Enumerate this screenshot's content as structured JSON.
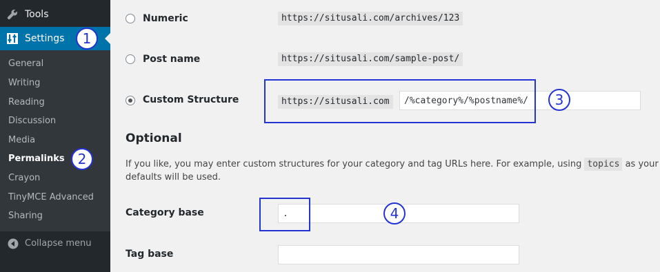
{
  "sidebar": {
    "tools_label": "Tools",
    "tools_icon": "wrench-icon",
    "settings_label": "Settings",
    "settings_icon": "sliders-icon",
    "submenu": [
      "General",
      "Writing",
      "Reading",
      "Discussion",
      "Media",
      "Permalinks",
      "Crayon",
      "TinyMCE Advanced",
      "Sharing"
    ],
    "current": "Permalinks",
    "collapse_label": "Collapse menu",
    "collapse_icon": "collapse-arrow-icon"
  },
  "permalinks": {
    "numeric_label": "Numeric",
    "numeric_example": "https://situsali.com/archives/123",
    "postname_label": "Post name",
    "postname_example": "https://situsali.com/sample-post/",
    "custom_label": "Custom Structure",
    "custom_prefix": "https://situsali.com",
    "custom_value": "/%category%/%postname%/",
    "selected": "Custom Structure"
  },
  "optional": {
    "heading": "Optional",
    "desc_part1": "If you like, you may enter custom structures for your category and tag URLs here. For example, using",
    "desc_code": "topics",
    "desc_part2": "as your",
    "desc_line2": "defaults will be used.",
    "category_base_label": "Category base",
    "category_base_value": ".",
    "tag_base_label": "Tag base",
    "tag_base_value": ""
  },
  "annotations": [
    "1",
    "2",
    "3",
    "4"
  ],
  "colors": {
    "sidebar_bg": "#23282d",
    "submenu_bg": "#32373c",
    "active_bg": "#0073aa",
    "annotation": "#2332d3"
  }
}
